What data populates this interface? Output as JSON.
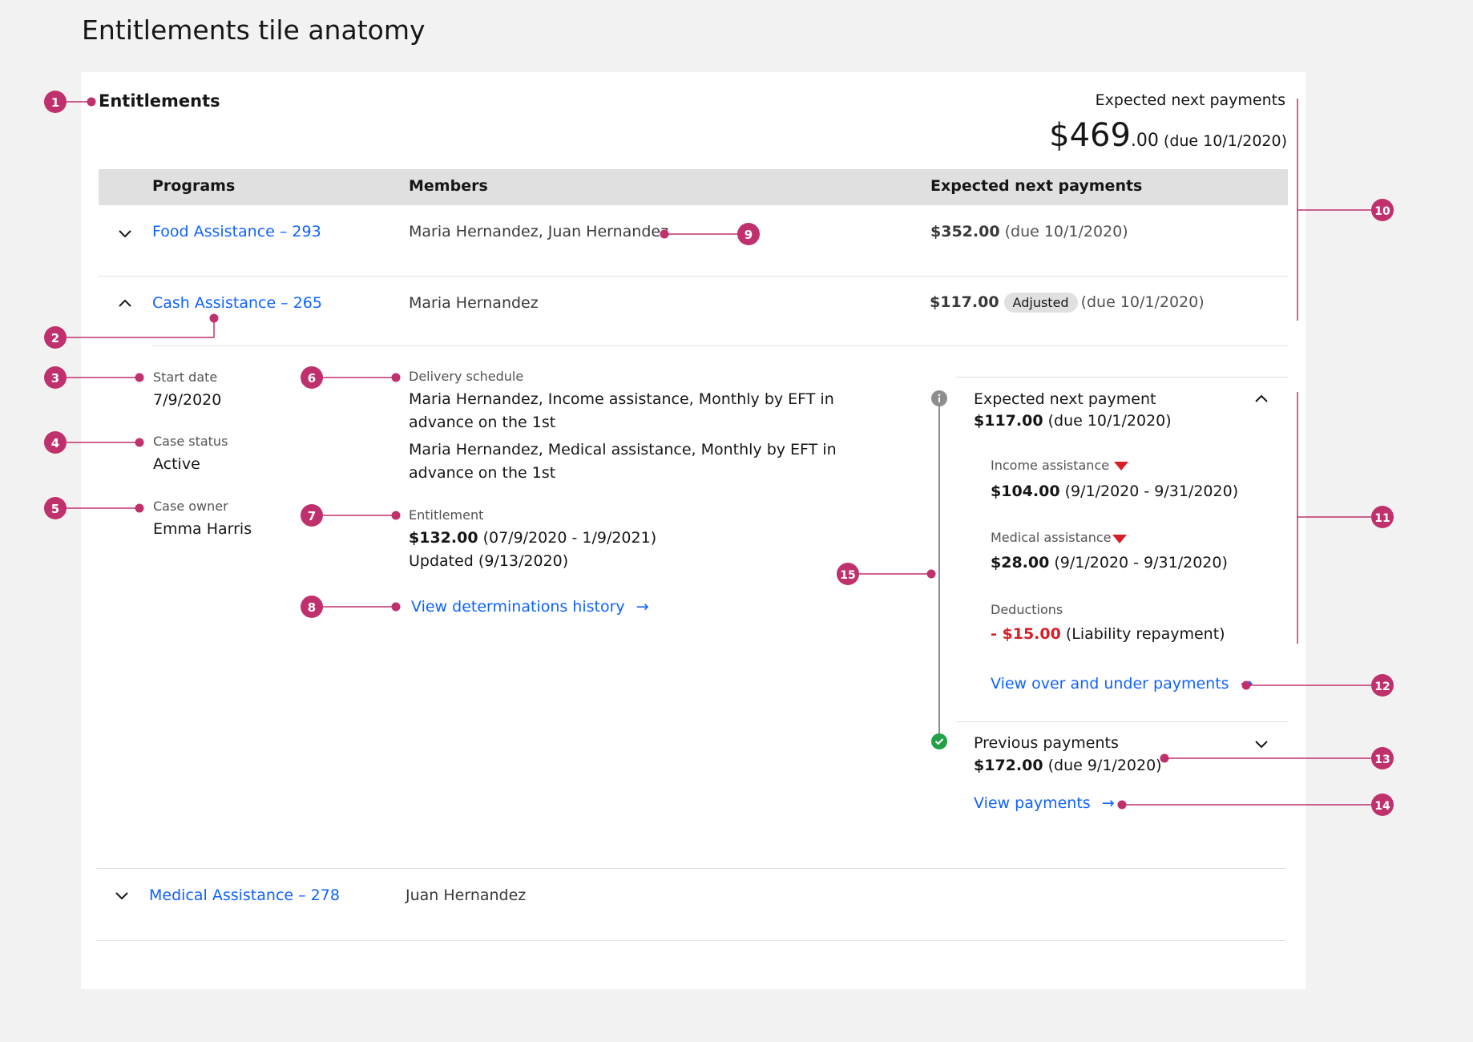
{
  "page": {
    "title": "Entitlements tile anatomy"
  },
  "tile": {
    "title": "Entitlements",
    "summary_label": "Expected next payments",
    "summary_amount_main": "$469",
    "summary_amount_cents": ".00",
    "summary_due": "(due 10/1/2020)"
  },
  "table": {
    "headers": [
      "Programs",
      "Members",
      "Expected next payments"
    ],
    "rows": [
      {
        "program": "Food Assistance – 293",
        "members": "Maria Hernandez, Juan Hernandez",
        "amount": "$352.00",
        "tag": "",
        "due": "(due 10/1/2020)",
        "expanded": false
      },
      {
        "program": "Cash Assistance – 265",
        "members": "Maria Hernandez",
        "amount": "$117.00",
        "tag": "Adjusted",
        "due": "(due 10/1/2020)",
        "expanded": true
      },
      {
        "program": "Medical Assistance – 278",
        "members": "Juan Hernandez",
        "amount": "",
        "tag": "",
        "due": "",
        "expanded": false
      }
    ]
  },
  "details": {
    "start_date_label": "Start date",
    "start_date": "7/9/2020",
    "case_status_label": "Case status",
    "case_status": "Active",
    "case_owner_label": "Case owner",
    "case_owner": "Emma Harris",
    "delivery_label": "Delivery schedule",
    "delivery_1": "Maria Hernandez, Income assistance, Monthly by EFT in advance on the 1st",
    "delivery_2": "Maria Hernandez, Medical assistance, Monthly by EFT in advance on the 1st",
    "entitlement_label": "Entitlement",
    "entitlement_amount": "$132.00",
    "entitlement_range": "(07/9/2020 - 1/9/2021)",
    "entitlement_updated": "Updated (9/13/2020)",
    "history_link": "View determinations history"
  },
  "panel": {
    "next_title": "Expected next payment",
    "next_amount": "$117.00",
    "next_due": "(due 10/1/2020)",
    "income_label": "Income assistance",
    "income_amount": "$104.00",
    "income_range": "(9/1/2020 - 9/31/2020)",
    "medical_label": "Medical assistance",
    "medical_amount": "$28.00",
    "medical_range": "(9/1/2020 - 9/31/2020)",
    "deductions_label": "Deductions",
    "deductions_amount": "- $15.00",
    "deductions_note": "(Liability repayment)",
    "over_under_link": "View over and under payments",
    "previous_title": "Previous payments",
    "previous_amount": "$172.00",
    "previous_due": "(due 9/1/2020)",
    "view_payments_link": "View payments"
  },
  "annotations": [
    "1",
    "2",
    "3",
    "4",
    "5",
    "6",
    "7",
    "8",
    "9",
    "10",
    "11",
    "12",
    "13",
    "14",
    "15"
  ],
  "colors": {
    "accent": "#c0306d",
    "link": "#0f62fe",
    "negative": "#da1e28",
    "success": "#24a148",
    "info": "#8d8d8d"
  }
}
